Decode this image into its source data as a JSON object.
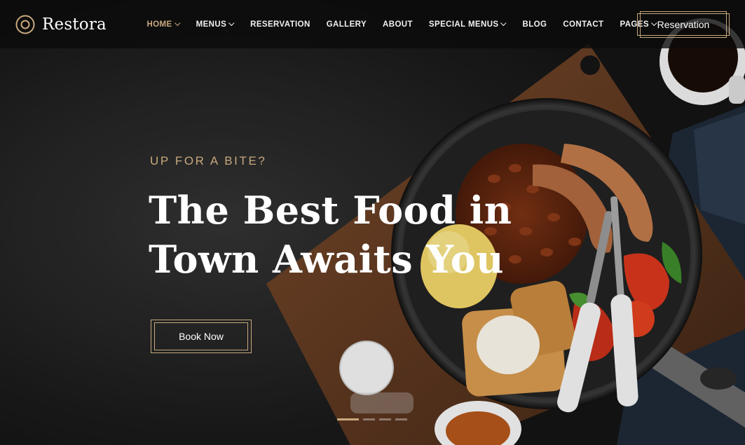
{
  "brand": {
    "name": "Restora",
    "logo_icon": "ring-logo-icon"
  },
  "nav": {
    "items": [
      {
        "label": "HOME",
        "has_dropdown": true,
        "active": true
      },
      {
        "label": "MENUS",
        "has_dropdown": true,
        "active": false
      },
      {
        "label": "RESERVATION",
        "has_dropdown": false,
        "active": false
      },
      {
        "label": "GALLERY",
        "has_dropdown": false,
        "active": false
      },
      {
        "label": "ABOUT",
        "has_dropdown": false,
        "active": false
      },
      {
        "label": "SPECIAL MENUS",
        "has_dropdown": true,
        "active": false
      },
      {
        "label": "BLOG",
        "has_dropdown": false,
        "active": false
      },
      {
        "label": "CONTACT",
        "has_dropdown": false,
        "active": false
      },
      {
        "label": "PAGES",
        "has_dropdown": true,
        "active": false
      }
    ],
    "cta_label": "Reservation"
  },
  "hero": {
    "kicker": "UP FOR A BITE?",
    "headline_line1": "The Best Food in",
    "headline_line2": "Town Awaits You",
    "button_label": "Book Now"
  },
  "slider": {
    "count": 4,
    "active_index": 0
  },
  "colors": {
    "accent": "#c8a97e",
    "background": "#1a1a1a",
    "text": "#ffffff"
  }
}
